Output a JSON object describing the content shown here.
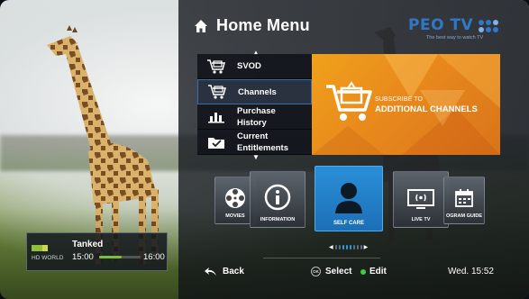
{
  "header": {
    "title": "Home Menu",
    "icon": "home-icon"
  },
  "brand": {
    "logo": "PEO TV",
    "tagline": "The best way to watch TV"
  },
  "categories": [
    {
      "label": "SVOD",
      "icon": "cart-tv-icon"
    },
    {
      "label": "Channels",
      "icon": "cart-tv-icon",
      "selected": true
    },
    {
      "label": "Purchase History",
      "icon": "bar-chart-icon"
    },
    {
      "label": "Current Entitlements",
      "icon": "checkbox-folder-icon"
    }
  ],
  "promo": {
    "line1": "SUBSCRIBE TO",
    "line2": "ADDITIONAL CHANNELS"
  },
  "tiles": [
    {
      "label": "MOVIES",
      "icon": "film-reel-icon"
    },
    {
      "label": "INFORMATION",
      "icon": "info-icon"
    },
    {
      "label": "SELF CARE",
      "icon": "user-icon",
      "selected": true
    },
    {
      "label": "LIVE TV",
      "icon": "broadcast-tv-icon"
    },
    {
      "label": "OGRAM GUIDE",
      "icon": "calendar-icon"
    }
  ],
  "footer": {
    "back": "Back",
    "select": "Select",
    "ok": "OK",
    "edit": "Edit",
    "clock": "Wed. 15:52"
  },
  "now_playing": {
    "channel": "HD WORLD",
    "title": "Tanked",
    "start": "15:00",
    "end": "16:00",
    "progress": 0.55
  },
  "colors": {
    "accent": "#2a8fd8",
    "promo": "#e8891c",
    "green": "#3ecf3e",
    "brand": "#2f78c9"
  }
}
